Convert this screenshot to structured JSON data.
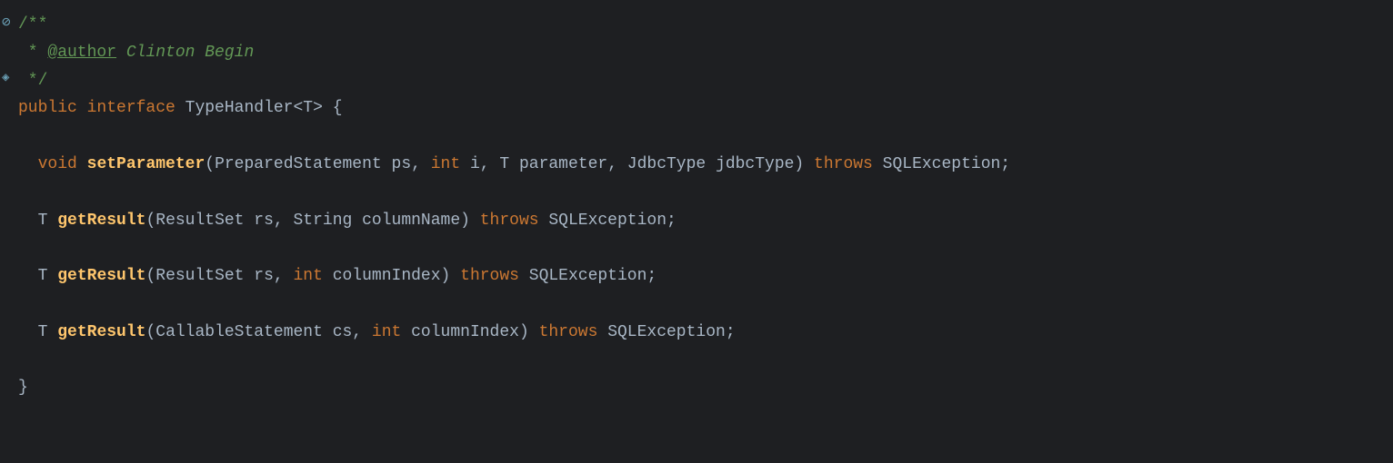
{
  "code": {
    "lines": [
      {
        "id": "line1",
        "hasBookmark": true,
        "content": "comment_start"
      },
      {
        "id": "line2",
        "hasBookmark": false,
        "content": "comment_author"
      },
      {
        "id": "line3",
        "hasBookmark": true,
        "content": "comment_end"
      },
      {
        "id": "line4",
        "hasBookmark": false,
        "content": "class_decl"
      },
      {
        "id": "line5",
        "hasBookmark": false,
        "content": "blank"
      },
      {
        "id": "line6",
        "hasBookmark": false,
        "content": "method1"
      },
      {
        "id": "line7",
        "hasBookmark": false,
        "content": "blank"
      },
      {
        "id": "line8",
        "hasBookmark": false,
        "content": "method2"
      },
      {
        "id": "line9",
        "hasBookmark": false,
        "content": "blank"
      },
      {
        "id": "line10",
        "hasBookmark": false,
        "content": "method3"
      },
      {
        "id": "line11",
        "hasBookmark": false,
        "content": "blank"
      },
      {
        "id": "line12",
        "hasBookmark": false,
        "content": "method4"
      },
      {
        "id": "line13",
        "hasBookmark": false,
        "content": "blank"
      },
      {
        "id": "line14",
        "hasBookmark": false,
        "content": "close_brace"
      }
    ]
  }
}
